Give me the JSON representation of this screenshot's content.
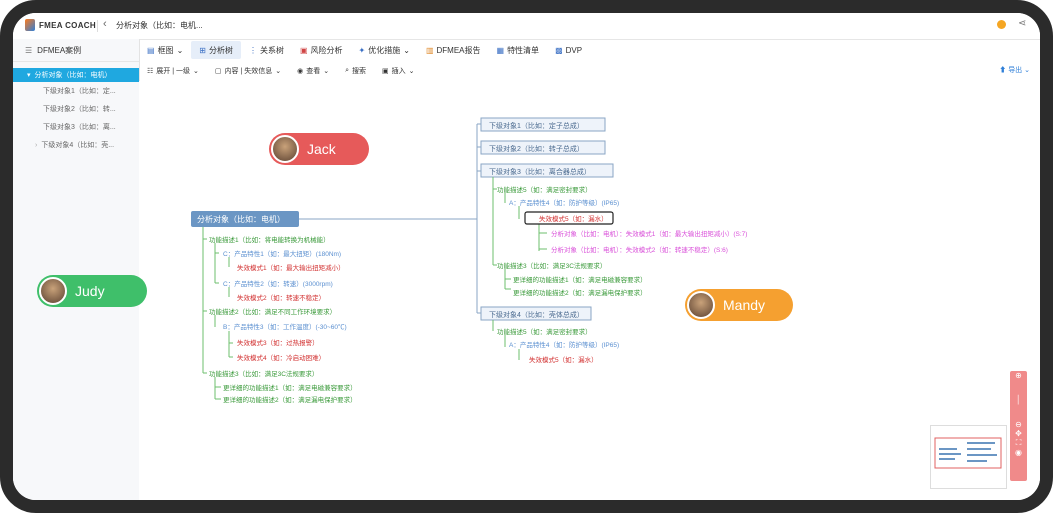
{
  "app": {
    "logo_text": "FMEA COACH",
    "doc_title": "分析对象（比如：电机..."
  },
  "sidebar": {
    "header": "DFMEA案例",
    "root": "分析对象（比如：电机）",
    "items": [
      {
        "label": "下级对象1（比如：定..."
      },
      {
        "label": "下级对象2（比如：转..."
      },
      {
        "label": "下级对象3（比如：离..."
      },
      {
        "label": "下级对象4（比如：壳..."
      }
    ]
  },
  "toolbar": {
    "tabs": [
      {
        "label": "框图",
        "icon": "block-diagram-icon"
      },
      {
        "label": "分析树",
        "icon": "tree-icon"
      },
      {
        "label": "关系树",
        "icon": "relation-icon"
      },
      {
        "label": "风险分析",
        "icon": "risk-icon"
      },
      {
        "label": "优化措施",
        "icon": "optimize-icon"
      },
      {
        "label": "DFMEA报告",
        "icon": "report-icon"
      },
      {
        "label": "特性清单",
        "icon": "list-icon"
      },
      {
        "label": "DVP",
        "icon": "dvp-icon"
      }
    ],
    "sub": [
      {
        "label": "展开 | 一级"
      },
      {
        "label": "内容 | 失效信息"
      },
      {
        "label": "查看"
      },
      {
        "label": "搜索"
      },
      {
        "label": "插入"
      }
    ],
    "export_label": "导出"
  },
  "users": [
    {
      "name": "Jack",
      "color": "#e65a5a"
    },
    {
      "name": "Judy",
      "color": "#3fbf6a"
    },
    {
      "name": "Mandy",
      "color": "#f5a030"
    }
  ],
  "tree": {
    "root": "分析对象（比如：电机）",
    "right": [
      "下级对象1（比如：定子总成）",
      "下级对象2（比如：转子总成）",
      "下级对象3（比如：离合器总成）",
      "下级对象4（比如：壳体总成）"
    ],
    "obj3_children": [
      "功能描述5（如：满足密封要求）",
      "A：产品特性4（如：防护等级）(IP65)",
      "失效模式5（如：漏水）",
      "分析对象（比如：电机）：失效模式1（如：最大输出扭矩减小）(S:7)",
      "分析对象（比如：电机）：失效模式2（如：转速不稳定）(S:6)",
      "功能描述3（比如：满足3C法规要求）",
      "更详细的功能描述1（如：满足电磁兼容要求）",
      "更详细的功能描述2（如：满足漏电保护要求）"
    ],
    "obj4_children": [
      "功能描述5（如：满足密封要求）",
      "A：产品特性4（如：防护等级）(IP65)",
      "失效模式5（如：漏水）"
    ],
    "left": [
      "功能描述1（比如：将电能转换为机械能）",
      "C：产品特性1（如：最大扭矩）(180Nm)",
      "失效模式1（如：最大输出扭矩减小）",
      "C：产品特性2（如：转速）(3000rpm)",
      "失效模式2（如：转速不稳定）",
      "功能描述2（比如：满足不同工作环境要求）",
      "B：产品特性3（如：工作温度）(-30~60℃)",
      "失效模式3（如：过热报警）",
      "失效模式4（如：冷启动困难）",
      "功能描述3（比如：满足3C法规要求）",
      "更详细的功能描述1（如：满足电磁兼容要求）",
      "更详细的功能描述2（如：满足漏电保护要求）"
    ]
  }
}
